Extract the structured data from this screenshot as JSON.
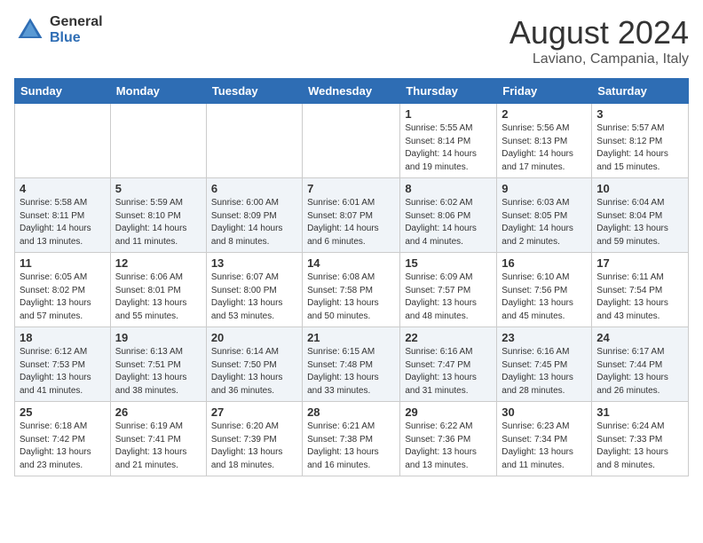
{
  "header": {
    "logo_general": "General",
    "logo_blue": "Blue",
    "month_year": "August 2024",
    "location": "Laviano, Campania, Italy"
  },
  "weekdays": [
    "Sunday",
    "Monday",
    "Tuesday",
    "Wednesday",
    "Thursday",
    "Friday",
    "Saturday"
  ],
  "weeks": [
    [
      {
        "day": "",
        "info": ""
      },
      {
        "day": "",
        "info": ""
      },
      {
        "day": "",
        "info": ""
      },
      {
        "day": "",
        "info": ""
      },
      {
        "day": "1",
        "info": "Sunrise: 5:55 AM\nSunset: 8:14 PM\nDaylight: 14 hours\nand 19 minutes."
      },
      {
        "day": "2",
        "info": "Sunrise: 5:56 AM\nSunset: 8:13 PM\nDaylight: 14 hours\nand 17 minutes."
      },
      {
        "day": "3",
        "info": "Sunrise: 5:57 AM\nSunset: 8:12 PM\nDaylight: 14 hours\nand 15 minutes."
      }
    ],
    [
      {
        "day": "4",
        "info": "Sunrise: 5:58 AM\nSunset: 8:11 PM\nDaylight: 14 hours\nand 13 minutes."
      },
      {
        "day": "5",
        "info": "Sunrise: 5:59 AM\nSunset: 8:10 PM\nDaylight: 14 hours\nand 11 minutes."
      },
      {
        "day": "6",
        "info": "Sunrise: 6:00 AM\nSunset: 8:09 PM\nDaylight: 14 hours\nand 8 minutes."
      },
      {
        "day": "7",
        "info": "Sunrise: 6:01 AM\nSunset: 8:07 PM\nDaylight: 14 hours\nand 6 minutes."
      },
      {
        "day": "8",
        "info": "Sunrise: 6:02 AM\nSunset: 8:06 PM\nDaylight: 14 hours\nand 4 minutes."
      },
      {
        "day": "9",
        "info": "Sunrise: 6:03 AM\nSunset: 8:05 PM\nDaylight: 14 hours\nand 2 minutes."
      },
      {
        "day": "10",
        "info": "Sunrise: 6:04 AM\nSunset: 8:04 PM\nDaylight: 13 hours\nand 59 minutes."
      }
    ],
    [
      {
        "day": "11",
        "info": "Sunrise: 6:05 AM\nSunset: 8:02 PM\nDaylight: 13 hours\nand 57 minutes."
      },
      {
        "day": "12",
        "info": "Sunrise: 6:06 AM\nSunset: 8:01 PM\nDaylight: 13 hours\nand 55 minutes."
      },
      {
        "day": "13",
        "info": "Sunrise: 6:07 AM\nSunset: 8:00 PM\nDaylight: 13 hours\nand 53 minutes."
      },
      {
        "day": "14",
        "info": "Sunrise: 6:08 AM\nSunset: 7:58 PM\nDaylight: 13 hours\nand 50 minutes."
      },
      {
        "day": "15",
        "info": "Sunrise: 6:09 AM\nSunset: 7:57 PM\nDaylight: 13 hours\nand 48 minutes."
      },
      {
        "day": "16",
        "info": "Sunrise: 6:10 AM\nSunset: 7:56 PM\nDaylight: 13 hours\nand 45 minutes."
      },
      {
        "day": "17",
        "info": "Sunrise: 6:11 AM\nSunset: 7:54 PM\nDaylight: 13 hours\nand 43 minutes."
      }
    ],
    [
      {
        "day": "18",
        "info": "Sunrise: 6:12 AM\nSunset: 7:53 PM\nDaylight: 13 hours\nand 41 minutes."
      },
      {
        "day": "19",
        "info": "Sunrise: 6:13 AM\nSunset: 7:51 PM\nDaylight: 13 hours\nand 38 minutes."
      },
      {
        "day": "20",
        "info": "Sunrise: 6:14 AM\nSunset: 7:50 PM\nDaylight: 13 hours\nand 36 minutes."
      },
      {
        "day": "21",
        "info": "Sunrise: 6:15 AM\nSunset: 7:48 PM\nDaylight: 13 hours\nand 33 minutes."
      },
      {
        "day": "22",
        "info": "Sunrise: 6:16 AM\nSunset: 7:47 PM\nDaylight: 13 hours\nand 31 minutes."
      },
      {
        "day": "23",
        "info": "Sunrise: 6:16 AM\nSunset: 7:45 PM\nDaylight: 13 hours\nand 28 minutes."
      },
      {
        "day": "24",
        "info": "Sunrise: 6:17 AM\nSunset: 7:44 PM\nDaylight: 13 hours\nand 26 minutes."
      }
    ],
    [
      {
        "day": "25",
        "info": "Sunrise: 6:18 AM\nSunset: 7:42 PM\nDaylight: 13 hours\nand 23 minutes."
      },
      {
        "day": "26",
        "info": "Sunrise: 6:19 AM\nSunset: 7:41 PM\nDaylight: 13 hours\nand 21 minutes."
      },
      {
        "day": "27",
        "info": "Sunrise: 6:20 AM\nSunset: 7:39 PM\nDaylight: 13 hours\nand 18 minutes."
      },
      {
        "day": "28",
        "info": "Sunrise: 6:21 AM\nSunset: 7:38 PM\nDaylight: 13 hours\nand 16 minutes."
      },
      {
        "day": "29",
        "info": "Sunrise: 6:22 AM\nSunset: 7:36 PM\nDaylight: 13 hours\nand 13 minutes."
      },
      {
        "day": "30",
        "info": "Sunrise: 6:23 AM\nSunset: 7:34 PM\nDaylight: 13 hours\nand 11 minutes."
      },
      {
        "day": "31",
        "info": "Sunrise: 6:24 AM\nSunset: 7:33 PM\nDaylight: 13 hours\nand 8 minutes."
      }
    ]
  ]
}
